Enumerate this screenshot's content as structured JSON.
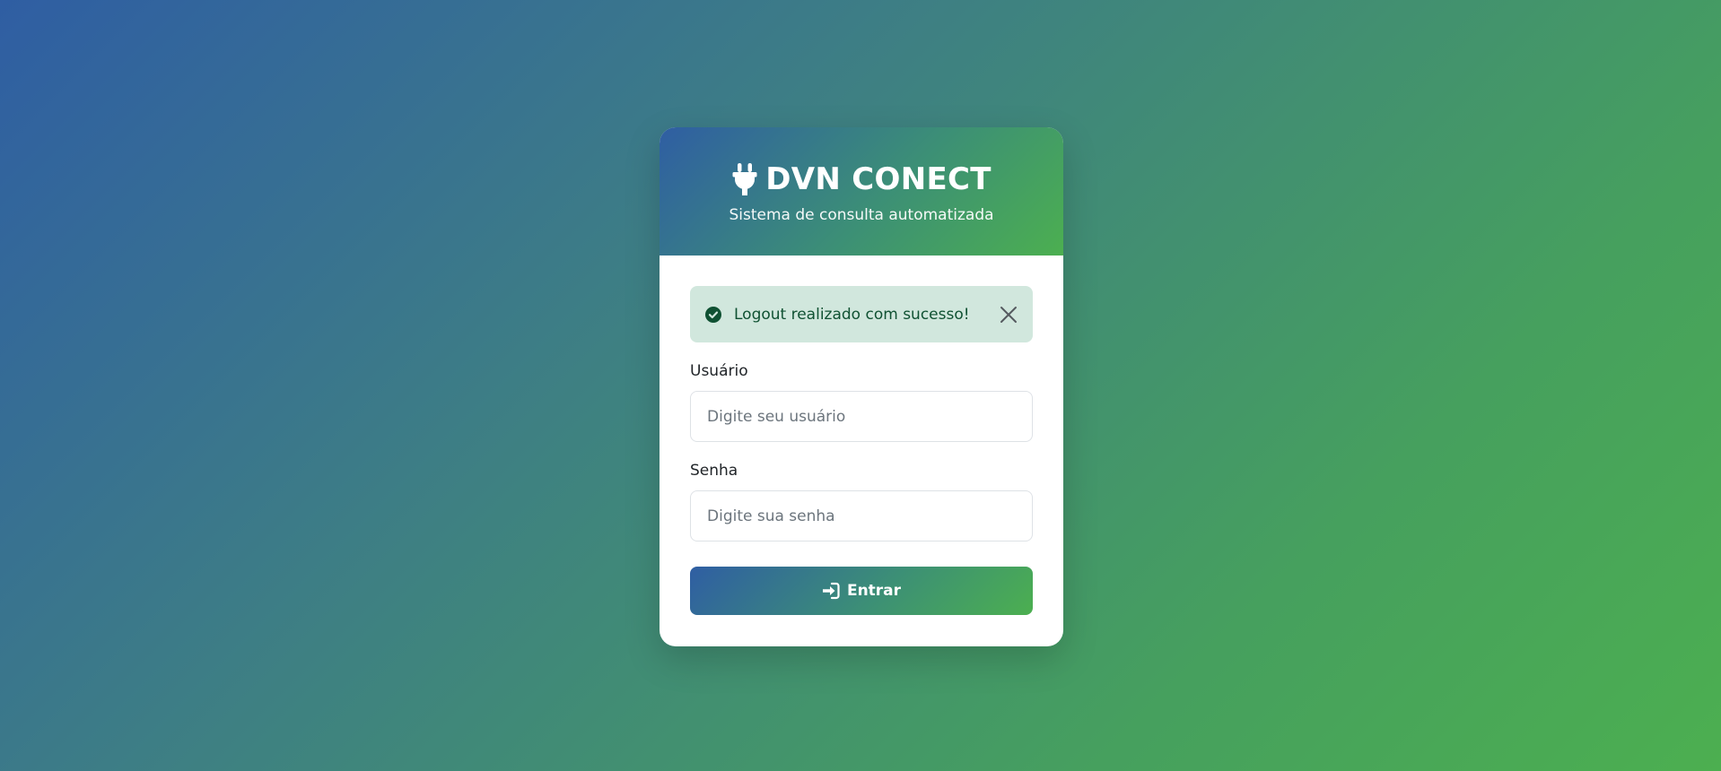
{
  "header": {
    "title": "DVN CONECT",
    "subtitle": "Sistema de consulta automatizada",
    "icon": "plug-icon"
  },
  "alert": {
    "message": "Logout realizado com sucesso!",
    "type": "success",
    "icon": "check-circle-icon",
    "close_icon": "close-icon"
  },
  "form": {
    "username": {
      "label": "Usuário",
      "placeholder": "Digite seu usuário",
      "value": ""
    },
    "password": {
      "label": "Senha",
      "placeholder": "Digite sua senha",
      "value": ""
    },
    "submit": {
      "label": "Entrar",
      "icon": "sign-in-icon"
    }
  },
  "colors": {
    "gradient_start": "#2f5ea3",
    "gradient_end": "#4caf50",
    "alert_bg": "#d1e7dd",
    "alert_text": "#0f5132"
  }
}
